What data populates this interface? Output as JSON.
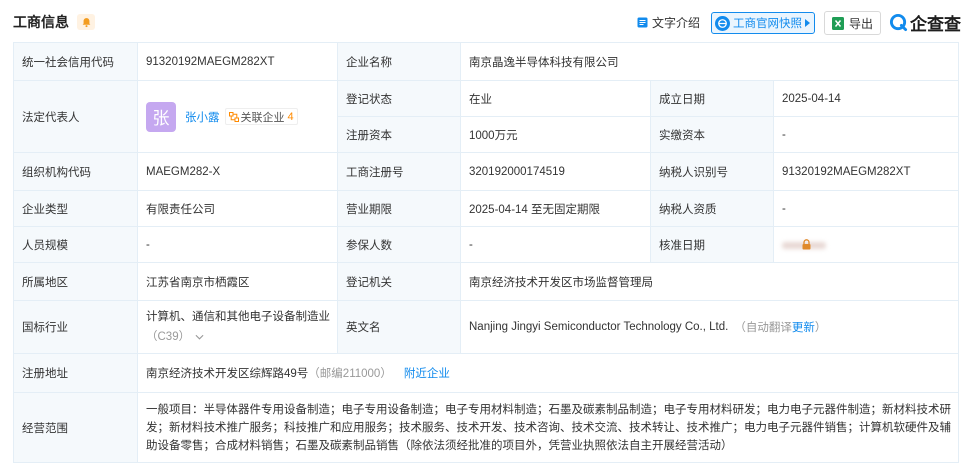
{
  "header": {
    "title": "工商信息",
    "text_intro": "文字介绍",
    "snapshot": "工商官网快照",
    "export": "导出",
    "logo": "企查查"
  },
  "icons": {
    "bell": "bell-icon",
    "text_intro": "document-icon",
    "snapshot": "globe-icon",
    "export": "excel-icon",
    "logo": "qcc-logo-icon",
    "related": "related-company-icon",
    "lock": "lock-icon",
    "expand": "chevron-down-icon"
  },
  "colors": {
    "link": "#128bed",
    "label_bg": "#f5f9fc",
    "border": "#e4eef6",
    "accent_orange": "#ff8a00",
    "muted": "#999999",
    "avatar_bg": "#c5a8f0"
  },
  "info": {
    "credit_code": {
      "label": "统一社会信用代码",
      "value": "91320192MAEGM282XT"
    },
    "company_name": {
      "label": "企业名称",
      "value": "南京晶逸半导体科技有限公司"
    },
    "legal_rep": {
      "label": "法定代表人",
      "avatar": "张",
      "name": "张小露",
      "related_label": "关联企业",
      "related_count": "4"
    },
    "reg_status": {
      "label": "登记状态",
      "value": "在业"
    },
    "founded": {
      "label": "成立日期",
      "value": "2025-04-14"
    },
    "reg_capital": {
      "label": "注册资本",
      "value": "1000万元"
    },
    "paid_capital": {
      "label": "实缴资本",
      "value": "-"
    },
    "org_code": {
      "label": "组织机构代码",
      "value": "MAEGM282-X"
    },
    "reg_no": {
      "label": "工商注册号",
      "value": "320192000174519"
    },
    "taxpayer_id": {
      "label": "纳税人识别号",
      "value": "91320192MAEGM282XT"
    },
    "company_type": {
      "label": "企业类型",
      "value": "有限责任公司"
    },
    "term": {
      "label": "营业期限",
      "value": "2025-04-14 至无固定期限"
    },
    "taxpayer_qual": {
      "label": "纳税人资质",
      "value": "-"
    },
    "staff_size": {
      "label": "人员规模",
      "value": "-"
    },
    "insured": {
      "label": "参保人数",
      "value": "-"
    },
    "approved": {
      "label": "核准日期"
    },
    "region": {
      "label": "所属地区",
      "value": "江苏省南京市栖霞区"
    },
    "authority": {
      "label": "登记机关",
      "value": "南京经济技术开发区市场监督管理局"
    },
    "industry": {
      "label": "国标行业",
      "value": "计算机、通信和其他电子设备制造业",
      "code": "（C39）"
    },
    "english_name": {
      "label": "英文名",
      "value": "Nanjing Jingyi Semiconductor Technology Co., Ltd.",
      "note_prefix": "（自动翻译",
      "note_link": "更新",
      "note_suffix": "）"
    },
    "address": {
      "label": "注册地址",
      "value": "南京经济技术开发区综辉路49号",
      "postcode": "（邮编211000）",
      "nearby_link": "附近企业"
    },
    "scope": {
      "label": "经营范围",
      "value": "一般项目：半导体器件专用设备制造；电子专用设备制造；电子专用材料制造；石墨及碳素制品制造；电子专用材料研发；电力电子元器件制造；新材料技术研发；新材料技术推广服务；科技推广和应用服务；技术服务、技术开发、技术咨询、技术交流、技术转让、技术推广；电力电子元器件销售；计算机软硬件及辅助设备零售；合成材料销售；石墨及碳素制品销售（除依法须经批准的项目外，凭营业执照依法自主开展经营活动）"
    }
  }
}
